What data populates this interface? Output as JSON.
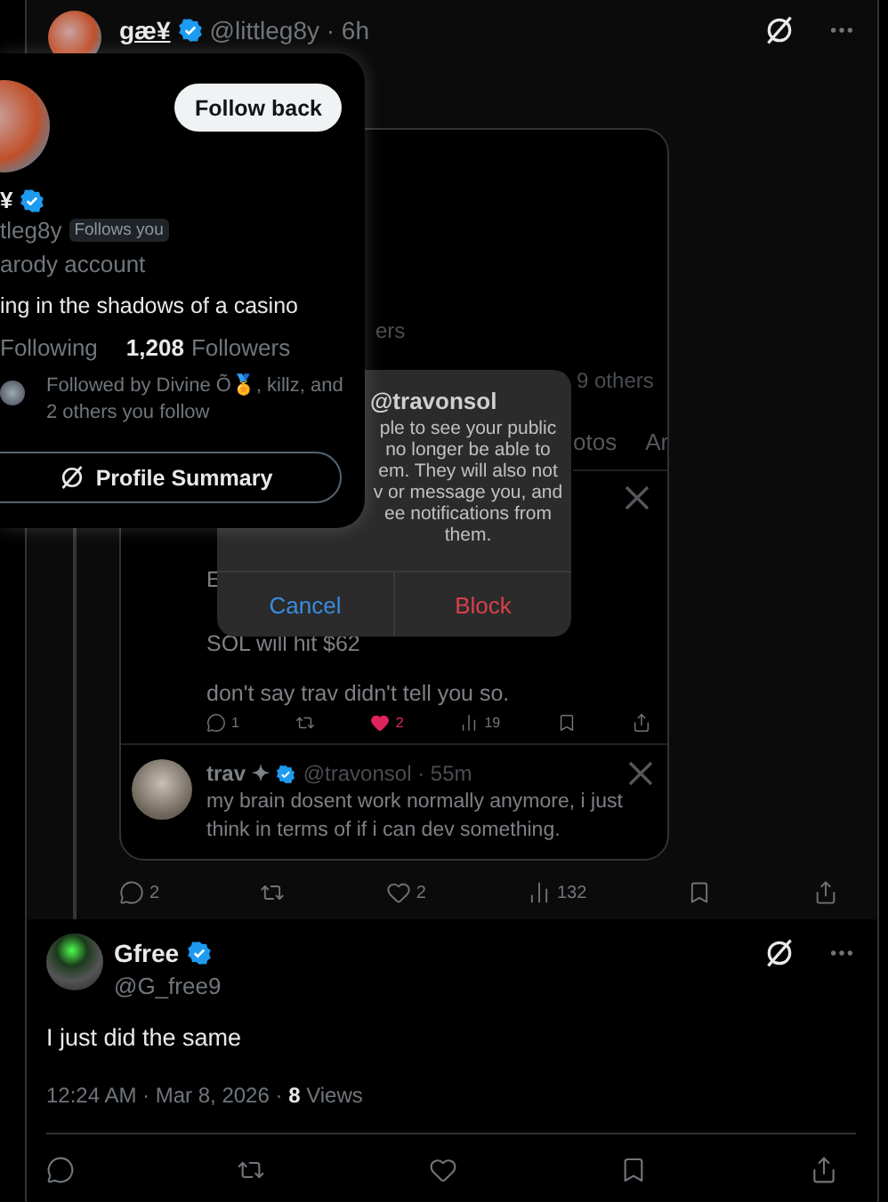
{
  "thread_post": {
    "author": "gæ¥",
    "handle": "@littleg8y · 6h",
    "attached_screenshot": {
      "fragments": [
        "ers",
        "9 others"
      ],
      "tabs": [
        "otos",
        "Ar"
      ],
      "cut_line": "E",
      "lines": [
        "SOL will hit $62",
        "don't say trav didn't tell you so."
      ],
      "actions": [
        {
          "kind": "reply",
          "count": "1",
          "active": false
        },
        {
          "kind": "repost",
          "active": false
        },
        {
          "kind": "like",
          "count": "2",
          "active": true
        },
        {
          "kind": "views",
          "count": "19",
          "active": false
        },
        {
          "kind": "bookmark",
          "active": false
        },
        {
          "kind": "share",
          "active": false
        }
      ],
      "reply": {
        "name": "trav ✦",
        "handle": "@travonsol · 55m",
        "text": "my brain dosent work normally anymore, i just think in terms of if i can dev something."
      },
      "dialog": {
        "title": "@travonsol",
        "lines": [
          "ple to see your public",
          "no longer be able to",
          "em. They will also not",
          "v or message you, and",
          "ee notifications from",
          "them."
        ],
        "buttons": [
          {
            "label": "Cancel",
            "kind": "cancel"
          },
          {
            "label": "Block",
            "kind": "destructive"
          }
        ]
      }
    },
    "actions": [
      {
        "kind": "reply",
        "count": "2"
      },
      {
        "kind": "repost"
      },
      {
        "kind": "like",
        "count": "2"
      },
      {
        "kind": "views",
        "count": "132"
      },
      {
        "kind": "bookmark"
      },
      {
        "kind": "share"
      }
    ]
  },
  "hover_card": {
    "follow_button": "Follow back",
    "name": "¥",
    "handle": "tleg8y",
    "follows_you": "Follows you",
    "label": "arody account",
    "bio": "ing in the shadows of a casino",
    "following_label": "Following",
    "followers_count": "1,208",
    "followers_label": "Followers",
    "followed_by": "Followed by Divine Õ🏅, killz, and 2 others you follow",
    "summary_button": "Profile Summary"
  },
  "reply_post": {
    "author": "Gfree",
    "handle": "@G_free9",
    "text": "I just did the same",
    "meta": "12:24 AM · Mar 8, 2026 · **8** Views",
    "actions": [
      {
        "kind": "reply"
      },
      {
        "kind": "repost"
      },
      {
        "kind": "like"
      },
      {
        "kind": "bookmark"
      },
      {
        "kind": "share"
      }
    ]
  }
}
